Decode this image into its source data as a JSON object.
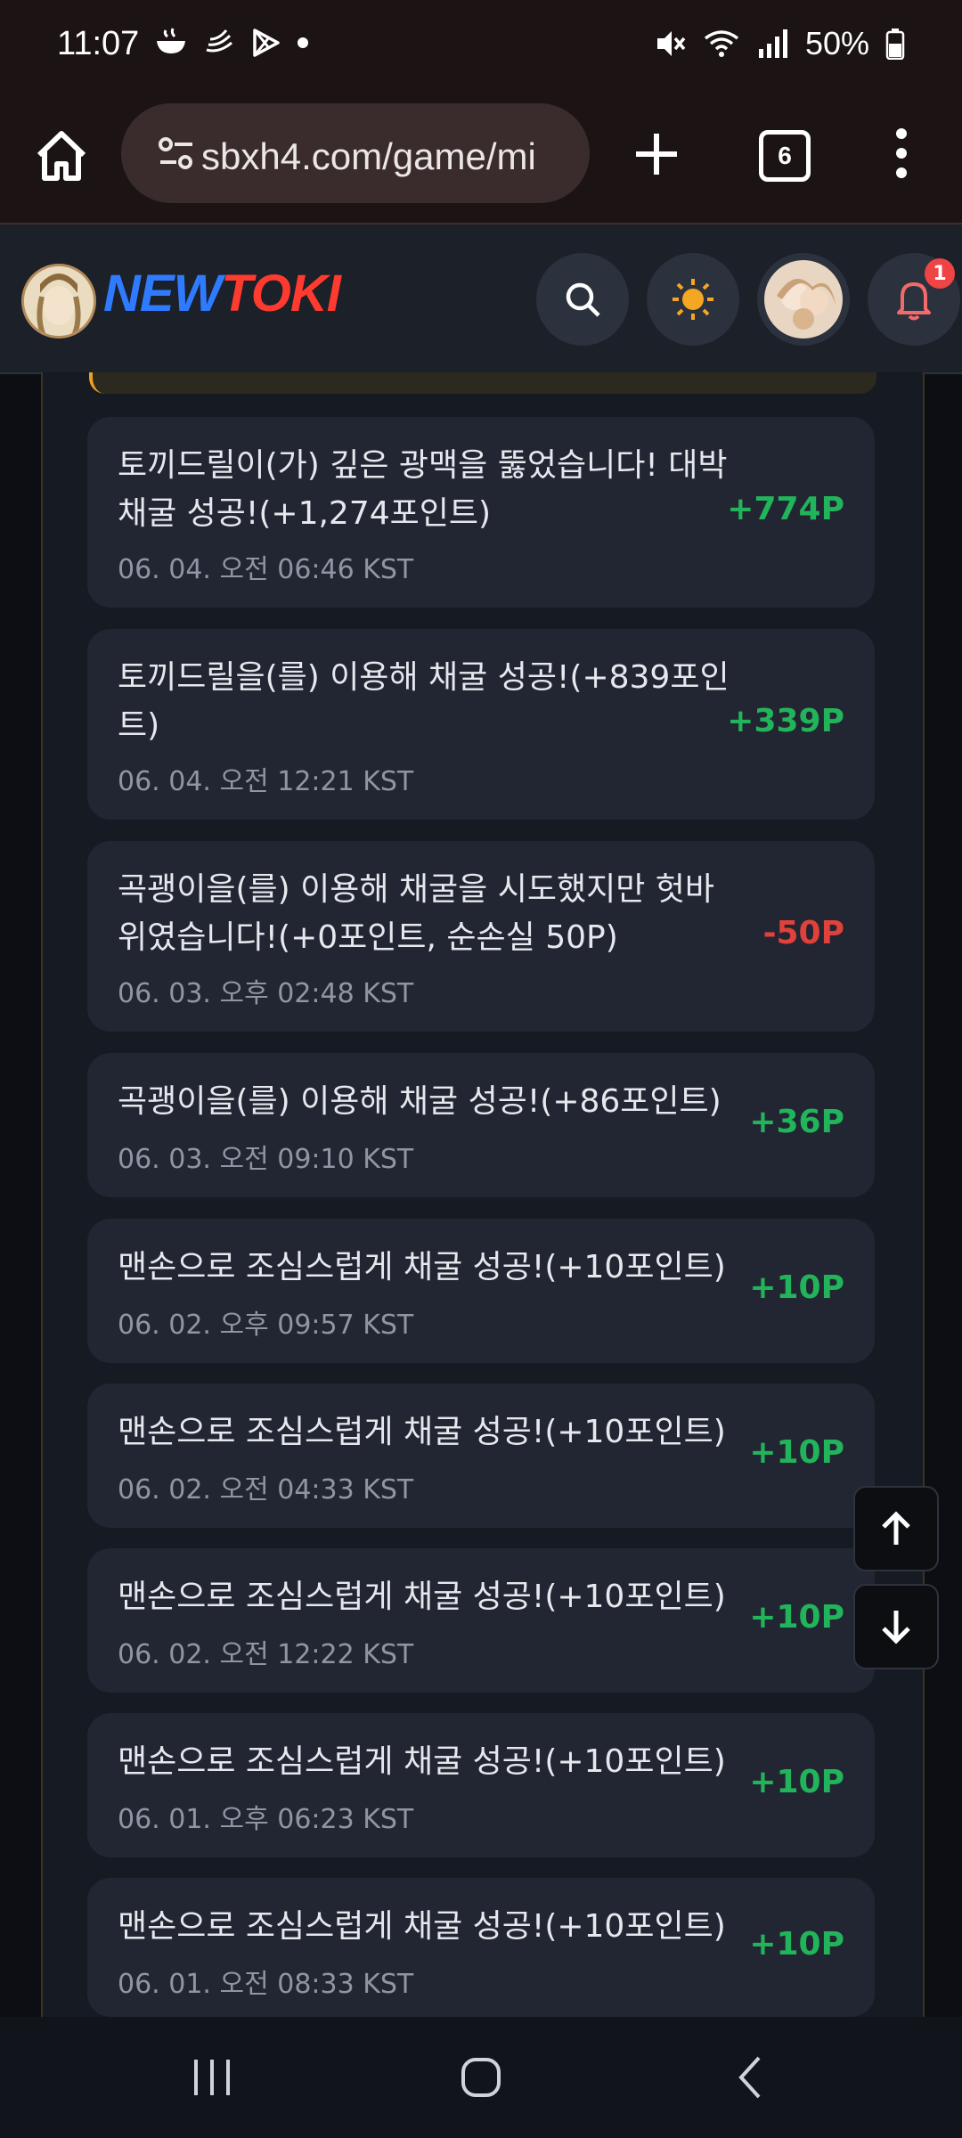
{
  "status_bar": {
    "time": "11:07",
    "battery": "50%",
    "icons": [
      "bowl-icon",
      "swirl-icon",
      "play-store-icon",
      "dot-icon",
      "mute-icon",
      "wifi-icon",
      "signal-icon",
      "battery-icon"
    ]
  },
  "browser": {
    "url": "sbxh4.com/game/mi",
    "tab_count": "6"
  },
  "site": {
    "logo_part1": "NEW",
    "logo_part2": "TOKI",
    "notification_count": "1"
  },
  "entries": [
    {
      "message": "토끼드릴이(가) 깊은 광맥을 뚫었습니다! 대박 채굴 성공!(+1,274포인트)",
      "time": "06. 04. 오전 06:46 KST",
      "points": "+774P",
      "type": "pos"
    },
    {
      "message": "토끼드릴을(를) 이용해 채굴 성공!(+839포인트)",
      "time": "06. 04. 오전 12:21 KST",
      "points": "+339P",
      "type": "pos"
    },
    {
      "message": "곡괭이을(를) 이용해 채굴을 시도했지만 헛바위였습니다!(+0포인트, 순손실 50P)",
      "time": "06. 03. 오후 02:48 KST",
      "points": "-50P",
      "type": "neg"
    },
    {
      "message": "곡괭이을(를) 이용해 채굴 성공!(+86포인트)",
      "time": "06. 03. 오전 09:10 KST",
      "points": "+36P",
      "type": "pos"
    },
    {
      "message": "맨손으로 조심스럽게 채굴 성공!(+10포인트)",
      "time": "06. 02. 오후 09:57 KST",
      "points": "+10P",
      "type": "pos"
    },
    {
      "message": "맨손으로 조심스럽게 채굴 성공!(+10포인트)",
      "time": "06. 02. 오전 04:33 KST",
      "points": "+10P",
      "type": "pos"
    },
    {
      "message": "맨손으로 조심스럽게 채굴 성공!(+10포인트)",
      "time": "06. 02. 오전 12:22 KST",
      "points": "+10P",
      "type": "pos"
    },
    {
      "message": "맨손으로 조심스럽게 채굴 성공!(+10포인트)",
      "time": "06. 01. 오후 06:23 KST",
      "points": "+10P",
      "type": "pos"
    },
    {
      "message": "맨손으로 조심스럽게 채굴 성공!(+10포인트)",
      "time": "06. 01. 오전 08:33 KST",
      "points": "+10P",
      "type": "pos"
    }
  ],
  "colors": {
    "positive": "#22b45a",
    "negative": "#e0413a",
    "card_bg": "#222632",
    "header_bg": "#1c2029"
  }
}
